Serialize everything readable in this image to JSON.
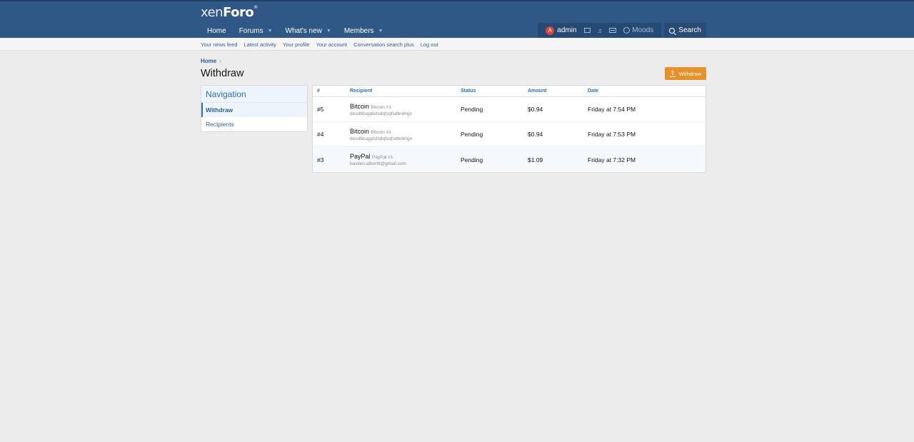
{
  "header": {
    "logo_prefix": "xen",
    "logo_bold": "Foro",
    "nav": [
      {
        "label": "Home",
        "caret": false
      },
      {
        "label": "Forums",
        "caret": true
      },
      {
        "label": "What's new",
        "caret": true
      },
      {
        "label": "Members",
        "caret": true
      }
    ],
    "user": {
      "avatar_letter": "A",
      "username": "admin",
      "moods_label": "Moods",
      "search_label": "Search"
    }
  },
  "subnav": [
    "Your news feed",
    "Latest activity",
    "Your profile",
    "Your account",
    "Conversation search plus",
    "Log out"
  ],
  "breadcrumb": {
    "home": "Home",
    "sep": "›"
  },
  "page_title": "Withdraw",
  "withdraw_button": "Withdraw",
  "sidebar": {
    "title": "Navigation",
    "items": [
      {
        "label": "Withdraw",
        "active": true
      },
      {
        "label": "Recipients",
        "active": false
      }
    ]
  },
  "table": {
    "columns": [
      "#",
      "Recipient",
      "Status",
      "Amount",
      "Date"
    ],
    "rows": [
      {
        "id": "#5",
        "name": "Bitcoin",
        "tag": "Bitcoin #1",
        "addr": "desdfdsqgdsfsdqfsqfsdbnbhjjn",
        "status": "Pending",
        "amount": "$0.94",
        "date": "Friday at 7:54 PM"
      },
      {
        "id": "#4",
        "name": "Bitcoin",
        "tag": "Bitcoin #1",
        "addr": "desdfdsqgdsfsdqfsqfsdbnbhjjn",
        "status": "Pending",
        "amount": "$0.94",
        "date": "Friday at 7:53 PM"
      },
      {
        "id": "#3",
        "name": "PayPal",
        "tag": "PayPal #1",
        "addr": "bastien.albert8@gmail.com",
        "status": "Pending",
        "amount": "$1.09",
        "date": "Friday at 7:32 PM"
      }
    ]
  }
}
